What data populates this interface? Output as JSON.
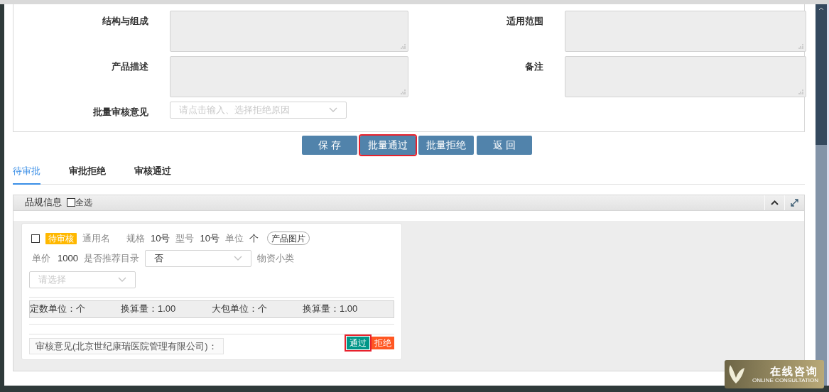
{
  "form": {
    "rows": [
      {
        "label": "结构与组成",
        "kind": "textarea"
      },
      {
        "label": "适用范围",
        "kind": "textarea"
      },
      {
        "label": "产品描述",
        "kind": "textarea"
      },
      {
        "label": "备注",
        "kind": "textarea"
      },
      {
        "label": "批量审核意见",
        "kind": "select",
        "placeholder": "请点击输入、选择拒绝原因"
      }
    ]
  },
  "actions": [
    {
      "label": "保 存",
      "outlined": false
    },
    {
      "label": "批量通过",
      "outlined": true
    },
    {
      "label": "批量拒绝",
      "outlined": false
    },
    {
      "label": "返 回",
      "outlined": false
    }
  ],
  "tabs": [
    {
      "label": "待审批",
      "selected": true
    },
    {
      "label": "审批拒绝",
      "selected": false
    },
    {
      "label": "审核通过",
      "selected": false
    }
  ],
  "panel": {
    "title": "品规信息",
    "select_all": {
      "label": "全选",
      "checked": false
    },
    "card": {
      "checked": false,
      "status": "待审核",
      "generic_name_label": "通用名",
      "spec_label": "规格",
      "spec": "10号",
      "model_label": "型号",
      "model": "10号",
      "unit_label": "单位",
      "unit": "个",
      "image_button": "产品图片",
      "price_label": "单价",
      "price": "1000",
      "recommend_label": "是否推荐目录",
      "recommend": "否",
      "category_label": "物资小类",
      "category_placeholder": "请选择",
      "units": [
        "定数单位：个",
        "换算量：1.00",
        "大包单位：个",
        "换算量：1.00"
      ],
      "opinion": "审核意见(北京世纪康瑞医院管理有限公司)：",
      "buttons": [
        {
          "label": "通过",
          "kind": "approve",
          "outlined": true
        },
        {
          "label": "拒绝",
          "kind": "reject",
          "outlined": false
        }
      ]
    }
  },
  "chat_widget": {
    "title": "在线咨询",
    "subtitle": "ONLINE CONSULTATION"
  }
}
